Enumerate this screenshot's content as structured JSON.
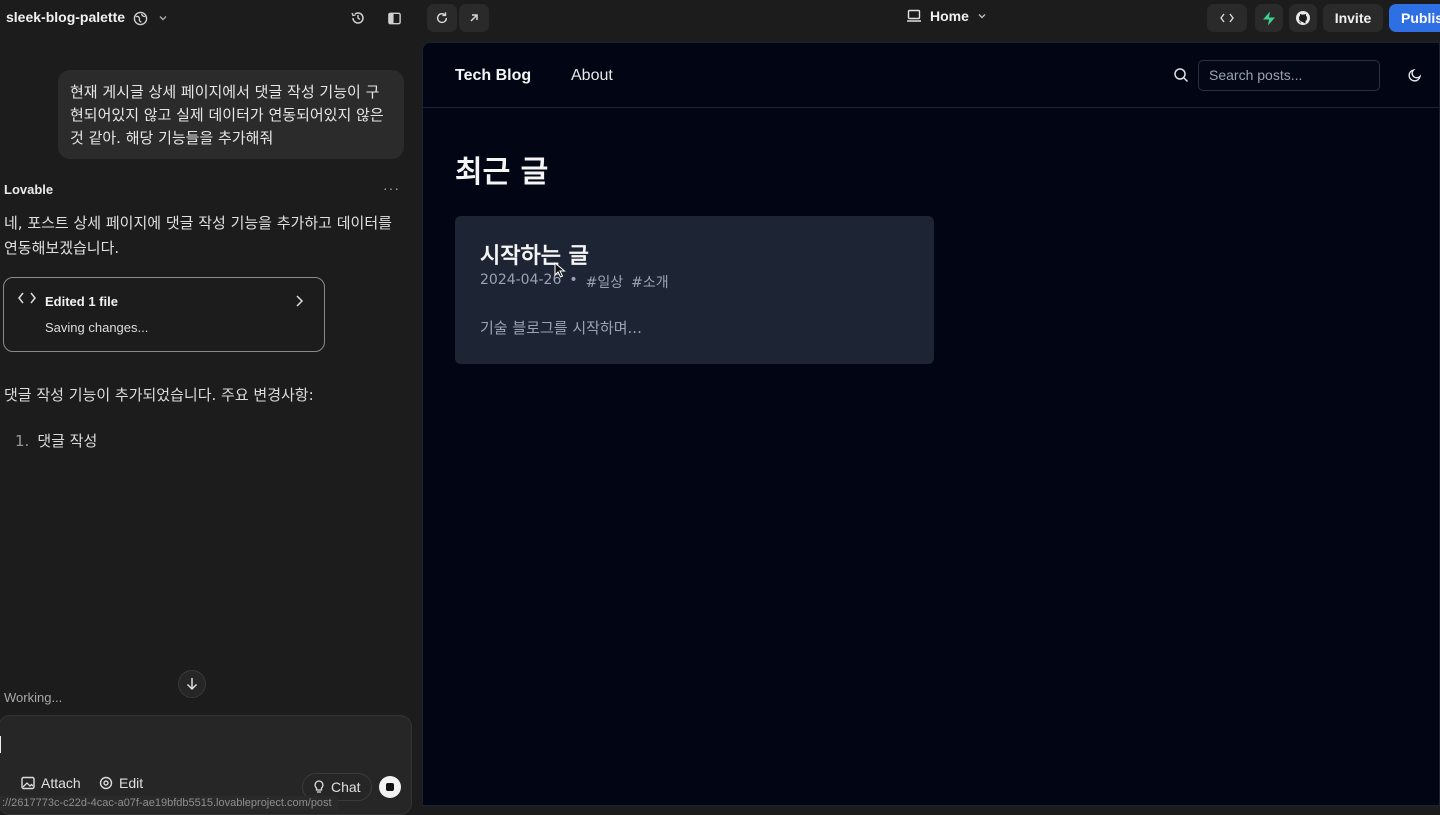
{
  "topbar": {
    "project_name": "sleek-blog-palette",
    "route_label": "Home",
    "invite_label": "Invite",
    "publish_label": "Publis",
    "icons": [
      "globe-icon",
      "chevron-down-icon",
      "history-icon",
      "sidebar-toggle-icon",
      "refresh-icon",
      "open-external-icon",
      "laptop-icon",
      "code-icon",
      "supabase-icon",
      "github-icon"
    ]
  },
  "chat": {
    "user_message": "현재 게시글 상세 페이지에서 댓글 작성 기능이 구현되어있지 않고 실제 데이터가 연동되어있지 않은 것 같아. 해당 기능들을 추가해줘",
    "assistant_name": "Lovable",
    "more_label": "···",
    "assistant_message": "네, 포스트 상세 페이지에 댓글 작성 기능을 추가하고 데이터를 연동해보겠습니다.",
    "edit_card": {
      "title": "Edited 1 file",
      "status": "Saving changes..."
    },
    "summary": "댓글 작성 기능이 추가되었습니다. 주요 변경사항:",
    "list": [
      {
        "num": "1.",
        "text": "댓글 작성"
      }
    ],
    "working_label": "Working...",
    "composer": {
      "attach_label": "Attach",
      "edit_label": "Edit",
      "chat_label": "Chat"
    },
    "status_url": "://2617773c-c22d-4cac-a07f-ae19bfdb5515.lovableproject.com/post"
  },
  "preview": {
    "brand": "Tech Blog",
    "nav_about": "About",
    "search_placeholder": "Search posts...",
    "section_title": "최근 글",
    "post": {
      "title": "시작하는 글",
      "date": "2024-04-26",
      "separator": "•",
      "tags": [
        "#일상",
        "#소개"
      ],
      "excerpt": "기술 블로그를 시작하며..."
    }
  },
  "colors": {
    "accent_publish": "#2f6fe4",
    "preview_bg": "#020614",
    "card_bg": "#1d2535",
    "supabase_green": "#3ecf8e"
  }
}
